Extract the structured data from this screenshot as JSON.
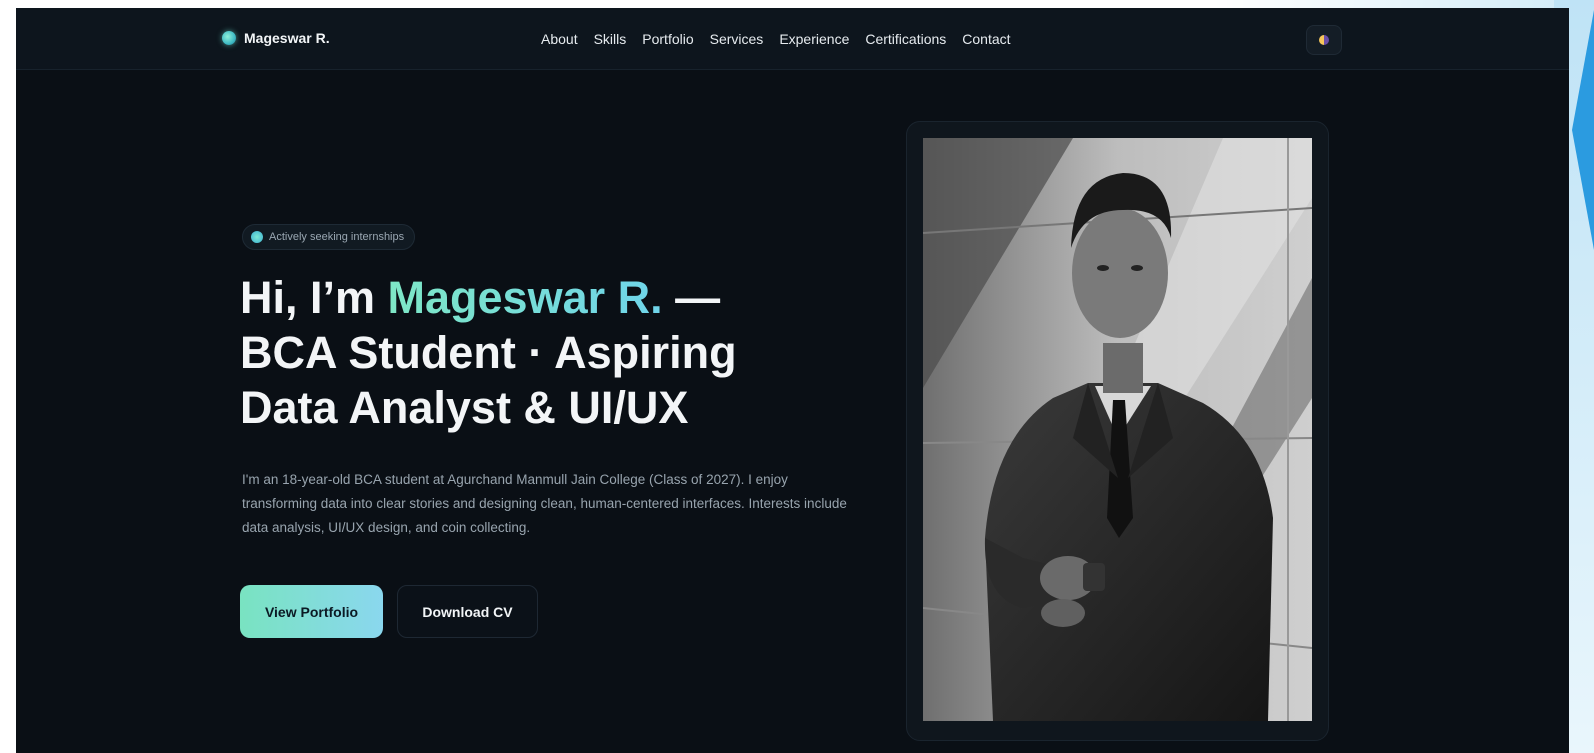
{
  "nav": {
    "brand": "Mageswar R.",
    "links": [
      "About",
      "Skills",
      "Portfolio",
      "Services",
      "Experience",
      "Certifications",
      "Contact"
    ],
    "theme_toggle_icon": "theme-toggle-icon"
  },
  "hero": {
    "badge": "Actively seeking internships",
    "headline_prefix": "Hi, I’m ",
    "headline_name": "Mageswar R.",
    "headline_dash": " —",
    "headline_line2": "BCA Student · Aspiring",
    "headline_line3": "Data Analyst & UI/UX",
    "description": "I'm an 18-year-old BCA student at Agurchand Manmull Jain College (Class of 2027). I enjoy transforming data into clear stories and designing clean, human-centered interfaces. Interests include data analysis, UI/UX design, and coin collecting.",
    "primary_button": "View Portfolio",
    "secondary_button": "Download CV"
  },
  "colors": {
    "background": "#0a0f15",
    "accent_start": "#7ee7c6",
    "accent_end": "#6fd4ea",
    "text_primary": "#f3f5f7",
    "text_muted": "#98a4ae"
  }
}
